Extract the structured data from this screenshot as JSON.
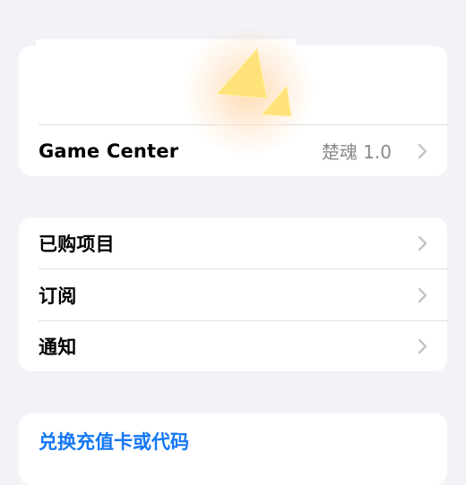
{
  "game_center_section": {
    "game_center": {
      "label": "Game Center",
      "value": "楚魂 1.0",
      "chevron_icon": "chevron-right-icon"
    }
  },
  "account_section": {
    "items": [
      {
        "label": "已购项目",
        "chevron_icon": "chevron-right-icon"
      },
      {
        "label": "订阅",
        "chevron_icon": "chevron-right-icon"
      },
      {
        "label": "通知",
        "chevron_icon": "chevron-right-icon"
      }
    ]
  },
  "redeem_section": {
    "redeem_label": "兑换充值卡或代码"
  },
  "colors": {
    "background": "#F2F2F7",
    "card": "#FFFFFF",
    "link_blue": "#1477F5",
    "secondary_text": "#8A8A8E",
    "chevron": "#C4C4C7",
    "sparkle": "#FFE27A"
  }
}
